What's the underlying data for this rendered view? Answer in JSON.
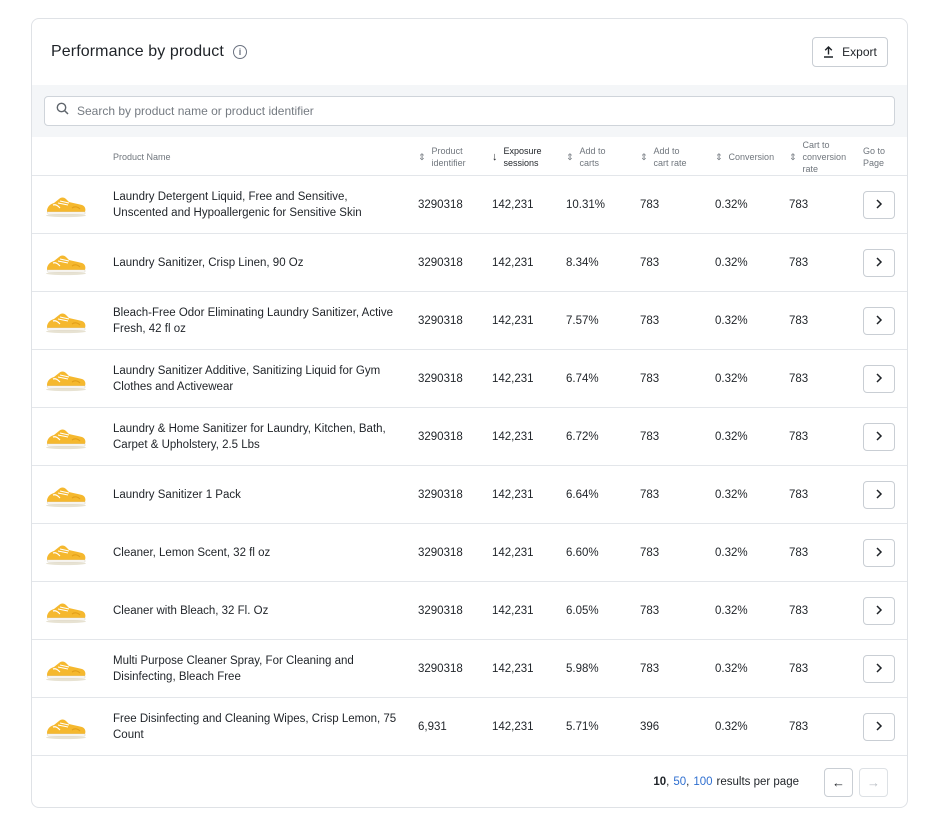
{
  "header": {
    "title": "Performance by product",
    "info_icon": "info-icon",
    "export_label": "Export",
    "export_icon": "upload-icon"
  },
  "search": {
    "placeholder": "Search by product name or product identifier",
    "value": ""
  },
  "columns": {
    "name": "Product Name",
    "identifier": "Product\nidentifier",
    "exposure": "Exposure\nsessions",
    "add_to_carts": "Add to\ncarts",
    "add_to_cart_rate": "Add to\ncart rate",
    "conversion": "Conversion",
    "cart_to_conversion": "Cart to\nconversion\nrate",
    "go_to_page": "Go to\nPage",
    "sorted_by": "exposure",
    "sort_direction": "descending"
  },
  "rows": [
    {
      "name": "Laundry Detergent Liquid, Free and Sensitive, Unscented and Hypoallergenic for Sensitive Skin",
      "identifier": "3290318",
      "exposure": "142,231",
      "add_to_carts": "10.31%",
      "add_to_cart_rate": "783",
      "conversion": "0.32%",
      "cart_to_conversion": "783"
    },
    {
      "name": "Laundry Sanitizer, Crisp Linen, 90 Oz",
      "identifier": "3290318",
      "exposure": "142,231",
      "add_to_carts": "8.34%",
      "add_to_cart_rate": "783",
      "conversion": "0.32%",
      "cart_to_conversion": "783"
    },
    {
      "name": "Bleach-Free Odor Eliminating Laundry Sanitizer, Active Fresh, 42 fl oz",
      "identifier": "3290318",
      "exposure": "142,231",
      "add_to_carts": "7.57%",
      "add_to_cart_rate": "783",
      "conversion": "0.32%",
      "cart_to_conversion": "783"
    },
    {
      "name": "Laundry Sanitizer Additive, Sanitizing Liquid for Gym Clothes and Activewear",
      "identifier": "3290318",
      "exposure": "142,231",
      "add_to_carts": "6.74%",
      "add_to_cart_rate": "783",
      "conversion": "0.32%",
      "cart_to_conversion": "783"
    },
    {
      "name": "Laundry & Home Sanitizer for Laundry, Kitchen, Bath, Carpet & Upholstery, 2.5 Lbs",
      "identifier": "3290318",
      "exposure": "142,231",
      "add_to_carts": "6.72%",
      "add_to_cart_rate": "783",
      "conversion": "0.32%",
      "cart_to_conversion": "783"
    },
    {
      "name": "Laundry Sanitizer 1 Pack",
      "identifier": "3290318",
      "exposure": "142,231",
      "add_to_carts": "6.64%",
      "add_to_cart_rate": "783",
      "conversion": "0.32%",
      "cart_to_conversion": "783"
    },
    {
      "name": "Cleaner, Lemon Scent, 32 fl oz",
      "identifier": "3290318",
      "exposure": "142,231",
      "add_to_carts": "6.60%",
      "add_to_cart_rate": "783",
      "conversion": "0.32%",
      "cart_to_conversion": "783"
    },
    {
      "name": "Cleaner with Bleach, 32 Fl. Oz",
      "identifier": "3290318",
      "exposure": "142,231",
      "add_to_carts": "6.05%",
      "add_to_cart_rate": "783",
      "conversion": "0.32%",
      "cart_to_conversion": "783"
    },
    {
      "name": "Multi Purpose Cleaner Spray, For Cleaning and Disinfecting, Bleach Free",
      "identifier": "3290318",
      "exposure": "142,231",
      "add_to_carts": "5.98%",
      "add_to_cart_rate": "783",
      "conversion": "0.32%",
      "cart_to_conversion": "783"
    },
    {
      "name": "Free Disinfecting and Cleaning Wipes, Crisp Lemon, 75 Count",
      "identifier": "6,931",
      "exposure": "142,231",
      "add_to_carts": "5.71%",
      "add_to_cart_rate": "396",
      "conversion": "0.32%",
      "cart_to_conversion": "783"
    }
  ],
  "row_icons": {
    "thumbnail": "yellow-sneaker-thumbnail",
    "go_button": "chevron-right-icon"
  },
  "footer": {
    "page_sizes": [
      "10",
      "50",
      "100"
    ],
    "selected_page_size": "10",
    "suffix": "results per page",
    "prev_icon": "arrow-left-icon",
    "next_icon": "arrow-right-icon",
    "prev_enabled": true,
    "next_enabled": false
  },
  "colors": {
    "link": "#2f6fd0",
    "border": "#dfe2e6",
    "search_band": "#f4f6f8",
    "shoe_yellow": "#f5b82e"
  }
}
